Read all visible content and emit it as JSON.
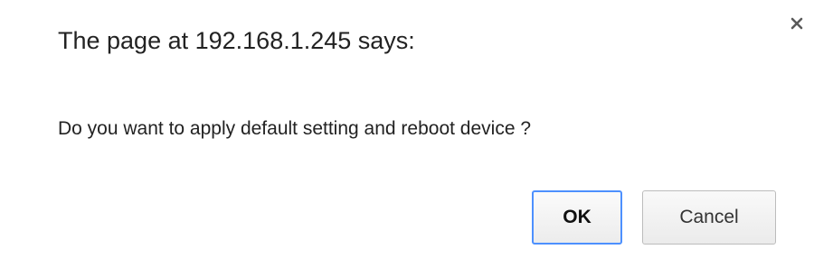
{
  "dialog": {
    "title": "The page at 192.168.1.245 says:",
    "message": "Do you want to apply default setting and reboot device ?",
    "close_icon": "close-icon",
    "ok_label": "OK",
    "cancel_label": "Cancel",
    "focus_color": "#4d90fe"
  }
}
